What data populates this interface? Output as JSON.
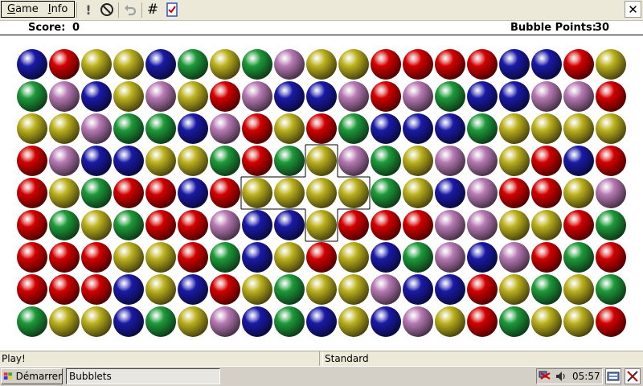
{
  "menu": {
    "game": "Game",
    "info": "Info"
  },
  "toolbar": {
    "hint_glyph": "!",
    "grid_glyph": "#"
  },
  "window": {
    "close_glyph": "✕"
  },
  "scorebar": {
    "score_label": "Score:",
    "score": "0",
    "points_label": "Bubble Points:",
    "points": "30"
  },
  "status": {
    "left": "Play!",
    "right": "Standard"
  },
  "taskbar": {
    "start": "Démarrer",
    "task": "Bubblets",
    "clock": "05:57"
  },
  "colors": {
    "R": "#d40000",
    "G": "#1e9a3a",
    "B": "#1a1aa8",
    "Y": "#bdb21e",
    "P": "#b77ab4"
  },
  "board": {
    "rows": [
      "BRYYBGYGPYYRRRRBBRY",
      "GPBYPYRPBBPRPGBBPPR",
      "YYPGGBPRYRGBBBGYYYY",
      "RPBBYYGRGYPGYPPYRBR",
      "RYGRRBRYYYYGYBPRRYP",
      "RGYGRRPBBYRRRPPYYRG",
      "RRRYYRGBYRYBGPBPRGR",
      "RRRBYBRYGYYPBBRYGYG",
      "GYYBGYPBGBYBPYRGYYR"
    ],
    "selected": [
      [
        3,
        9
      ],
      [
        4,
        7
      ],
      [
        4,
        8
      ],
      [
        4,
        9
      ],
      [
        4,
        10
      ],
      [
        5,
        9
      ]
    ]
  }
}
